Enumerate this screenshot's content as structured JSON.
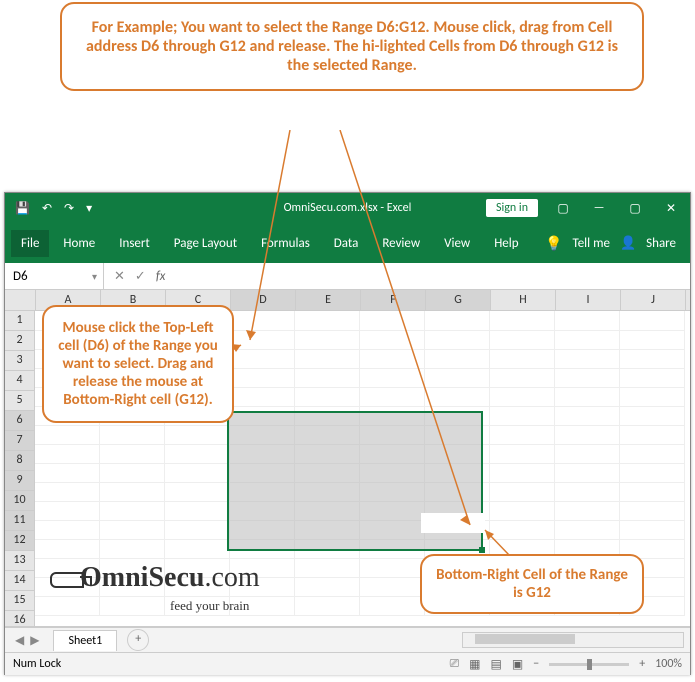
{
  "callouts": {
    "top": "For Example; You want to select the Range D6:G12. Mouse click, drag from Cell address D6 through G12 and release. The hi-lighted Cells from D6 through G12 is the selected Range.",
    "left": "Mouse click the Top-Left cell (D6) of the Range you want to select. Drag and release the mouse at Bottom-Right cell (G12).",
    "bottom": "Bottom-Right Cell of the Range is G12"
  },
  "window": {
    "title": "OmniSecu.com.xlsx - Excel",
    "signin": "Sign in"
  },
  "ribbon": {
    "file": "File",
    "tabs": [
      "Home",
      "Insert",
      "Page Layout",
      "Formulas",
      "Data",
      "Review",
      "View",
      "Help"
    ],
    "tellme": "Tell me",
    "share": "Share"
  },
  "formula": {
    "cell_ref": "D6",
    "fx": "fx"
  },
  "columns": [
    "A",
    "B",
    "C",
    "D",
    "E",
    "F",
    "G",
    "H",
    "I",
    "J"
  ],
  "rows": [
    "1",
    "2",
    "3",
    "4",
    "5",
    "6",
    "7",
    "8",
    "9",
    "10",
    "11",
    "12",
    "13",
    "14",
    "15",
    "16"
  ],
  "sheet": {
    "name": "Sheet1",
    "add": "+"
  },
  "status": {
    "numlock": "Num Lock",
    "zoom_minus": "−",
    "zoom_plus": "+",
    "zoom_pct": "100%"
  },
  "logo": {
    "text1": "OmniSecu",
    "text2": ".com",
    "tagline": "feed your brain"
  },
  "icons": {
    "save": "💾",
    "undo": "↶",
    "redo": "↷",
    "dropdown": "▾",
    "minimize": "—",
    "restore": "▢",
    "close": "✕",
    "bulb": "💡",
    "share_icon": "👤",
    "check": "✓",
    "x": "✕",
    "left": "◀",
    "right": "▶",
    "view1": "▦",
    "view2": "▤",
    "view3": "▣",
    "disp": "⎚"
  }
}
